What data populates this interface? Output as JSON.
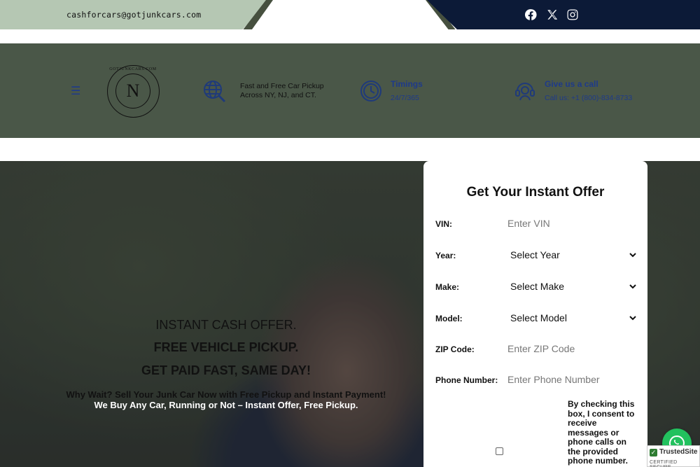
{
  "topbar": {
    "email": "cashforcars@gotjunkcars.com",
    "social": [
      {
        "icon": "facebook-icon"
      },
      {
        "icon": "x-icon"
      },
      {
        "icon": "instagram-icon"
      }
    ]
  },
  "header": {
    "menu_icon": "☰",
    "logo": {
      "ring_text": "GOTJUNKCARS.COM",
      "letter": "N"
    },
    "pickup": {
      "icon": "globe-search-icon",
      "line1": "Fast and Free Car Pickup",
      "line2": "Across NY, NJ, and CT."
    },
    "timings": {
      "icon": "clock-icon",
      "title": "Timings",
      "subtitle": "24/7/365"
    },
    "call": {
      "icon": "headset-icon",
      "title": "Give us a call",
      "subtitle": "Call us: +1 (800)-834-8733"
    }
  },
  "hero": {
    "line1": "INSTANT CASH OFFER.",
    "line2": "FREE VEHICLE PICKUP.",
    "line3": "GET PAID FAST, SAME DAY!",
    "sub1": "Why Wait? Sell Your Junk Car Now with Free Pickup and Instant Payment!",
    "sub2": "We Buy Any Car, Running or Not – Instant Offer, Free Pickup."
  },
  "form": {
    "title": "Get Your Instant Offer",
    "vin": {
      "label": "VIN:",
      "placeholder": "Enter VIN"
    },
    "year": {
      "label": "Year:",
      "value": "Select Year"
    },
    "make": {
      "label": "Make:",
      "value": "Select Make"
    },
    "model": {
      "label": "Model:",
      "value": "Select Model"
    },
    "zip": {
      "label": "ZIP Code:",
      "placeholder": "Enter ZIP Code"
    },
    "phone": {
      "label": "Phone Number:",
      "placeholder": "Enter Phone Number"
    },
    "consent": "By checking this box, I consent to receive messages or phone calls on the provided phone number."
  },
  "trust_badge": {
    "name": "TrustedSite",
    "sub": "CERTIFIED SECURE"
  },
  "colors": {
    "accent": "#1e3a8a",
    "header_bg": "#4a5748",
    "topbar_left": "#b5c7b3",
    "topbar_right": "#0c1a37",
    "whatsapp": "#22c15e"
  }
}
